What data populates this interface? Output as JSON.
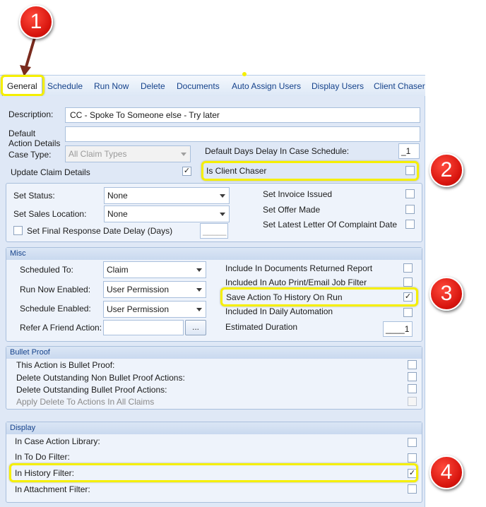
{
  "tabs": [
    "General",
    "Schedule",
    "Run Now",
    "Delete",
    "Documents",
    "Auto Assign Users",
    "Display Users",
    "Client Chaser"
  ],
  "badges": [
    "1",
    "2",
    "3",
    "4"
  ],
  "general": {
    "description_label": "Description:",
    "description_value": "CC - Spoke To Someone else - Try later",
    "default_action_label_line1": "Default",
    "default_action_label_line2": "Action Details",
    "case_type_label": "Case Type:",
    "case_type_value": "All Claim Types",
    "default_days_label": "Default Days Delay In Case Schedule:",
    "default_days_value": "_1",
    "update_claim_label": "Update Claim Details",
    "update_claim_checked": "✓",
    "is_client_chaser_label": "Is Client Chaser"
  },
  "status_panel": {
    "set_status_label": "Set Status:",
    "set_status_value": "None",
    "set_sales_location_label": "Set Sales Location:",
    "set_sales_location_value": "None",
    "set_final_response_label": "Set Final Response Date Delay (Days)",
    "final_response_value": "_____",
    "set_invoice_issued_label": "Set Invoice Issued",
    "set_offer_made_label": "Set Offer Made",
    "set_latest_letter_label": "Set Latest Letter Of Complaint Date"
  },
  "misc": {
    "title": "Misc",
    "scheduled_to_label": "Scheduled To:",
    "scheduled_to_value": "Claim",
    "run_now_label": "Run Now Enabled:",
    "run_now_value": "User Permission",
    "schedule_enabled_label": "Schedule Enabled:",
    "schedule_enabled_value": "User Permission",
    "refer_friend_label": "Refer A Friend Action:",
    "ellipsis_label": "...",
    "include_docs_label": "Include In Documents Returned Report",
    "include_auto_print_label": "Included In Auto Print/Email Job Filter",
    "save_history_label": "Save Action To History On Run",
    "save_history_checked": "✓",
    "included_daily_label": "Included In Daily Automation",
    "estimated_duration_label": "Estimated Duration",
    "estimated_duration_value": "____1"
  },
  "bullet_proof": {
    "title": "Bullet Proof",
    "items": [
      "This Action is Bullet Proof:",
      "Delete Outstanding Non Bullet Proof Actions:",
      "Delete Outstanding Bullet Proof Actions:",
      "Apply Delete To Actions In All Claims"
    ]
  },
  "display": {
    "title": "Display",
    "items": [
      "In Case Action Library:",
      "In To Do Filter:",
      "In History Filter:",
      "In Attachment Filter:"
    ],
    "history_checked": "✓"
  },
  "colors": {
    "highlight": "#f5ef00",
    "badge": "#d8150e",
    "tab_text": "#15428b",
    "panel_bg": "#dfe8f6"
  }
}
